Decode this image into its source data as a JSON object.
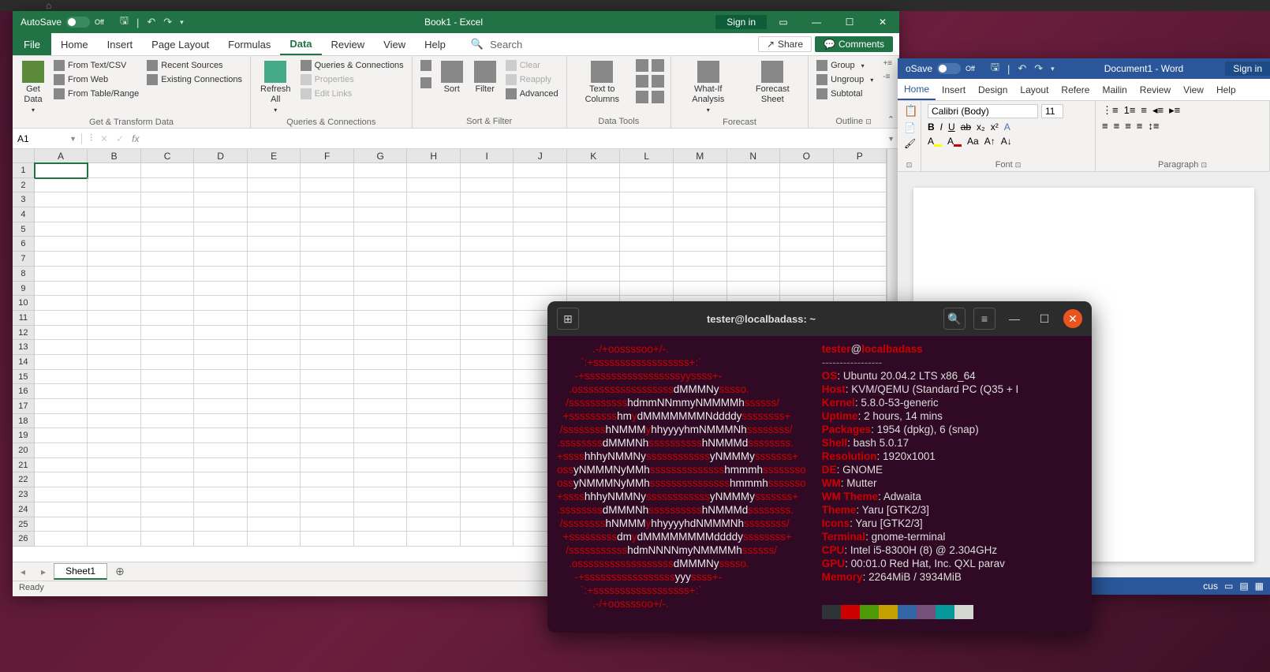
{
  "ubuntu": {
    "home_icon": "⌂"
  },
  "excel": {
    "autosave_label": "AutoSave",
    "autosave_state": "Off",
    "title": "Book1 - Excel",
    "signin": "Sign in",
    "tabs": [
      "File",
      "Home",
      "Insert",
      "Page Layout",
      "Formulas",
      "Data",
      "Review",
      "View",
      "Help"
    ],
    "active_tab": "Data",
    "search_label": "Search",
    "share": "Share",
    "comments": "Comments",
    "ribbon": {
      "get_data": "Get\nData",
      "from_text_csv": "From Text/CSV",
      "from_web": "From Web",
      "from_table": "From Table/Range",
      "recent_sources": "Recent Sources",
      "existing_conn": "Existing Connections",
      "group1": "Get & Transform Data",
      "refresh_all": "Refresh\nAll",
      "queries_conn": "Queries & Connections",
      "properties": "Properties",
      "edit_links": "Edit Links",
      "group2": "Queries & Connections",
      "sort": "Sort",
      "filter": "Filter",
      "clear": "Clear",
      "reapply": "Reapply",
      "advanced": "Advanced",
      "group3": "Sort & Filter",
      "text_to_cols": "Text to\nColumns",
      "group4": "Data Tools",
      "whatif": "What-If\nAnalysis",
      "forecast_sheet": "Forecast\nSheet",
      "group5": "Forecast",
      "group_btn": "Group",
      "ungroup": "Ungroup",
      "subtotal": "Subtotal",
      "group6": "Outline"
    },
    "namebox": "A1",
    "columns": [
      "A",
      "B",
      "C",
      "D",
      "E",
      "F",
      "G",
      "H",
      "I",
      "J",
      "K",
      "L",
      "M",
      "N",
      "O",
      "P"
    ],
    "rows": 26,
    "sheet": "Sheet1",
    "status": "Ready"
  },
  "word": {
    "autosave_label": "oSave",
    "autosave_state": "Off",
    "title": "Document1 - Word",
    "signin": "Sign in",
    "tabs": [
      "Home",
      "Insert",
      "Design",
      "Layout",
      "Refere",
      "Mailin",
      "Review",
      "View",
      "Help"
    ],
    "active_tab": "Home",
    "font": "Calibri (Body)",
    "size": "11",
    "group_font": "Font",
    "group_para": "Paragraph",
    "status_focus": "cus"
  },
  "term": {
    "title": "tester@localbadass: ~",
    "user": "tester",
    "host": "localbadass",
    "dashes": "-----------------",
    "info": {
      "OS": "Ubuntu 20.04.2 LTS x86_64",
      "Host": "KVM/QEMU (Standard PC (Q35 + I",
      "Kernel": "5.8.0-53-generic",
      "Uptime": "2 hours, 14 mins",
      "Packages": "1954 (dpkg), 6 (snap)",
      "Shell": "bash 5.0.17",
      "Resolution": "1920x1001",
      "DE": "GNOME",
      "WM": "Mutter",
      "WM Theme": "Adwaita",
      "Theme": "Yaru [GTK2/3]",
      "Icons": "Yaru [GTK2/3]",
      "Terminal": "gnome-terminal",
      "CPU": "Intel i5-8300H (8) @ 2.304GHz",
      "GPU": "00:01.0 Red Hat, Inc. QXL parav",
      "Memory": "2264MiB / 3934MiB"
    },
    "palette": [
      "#2e3436",
      "#cc0000",
      "#4e9a06",
      "#c4a000",
      "#3465a4",
      "#75507b",
      "#06989a",
      "#d3d7cf"
    ]
  }
}
